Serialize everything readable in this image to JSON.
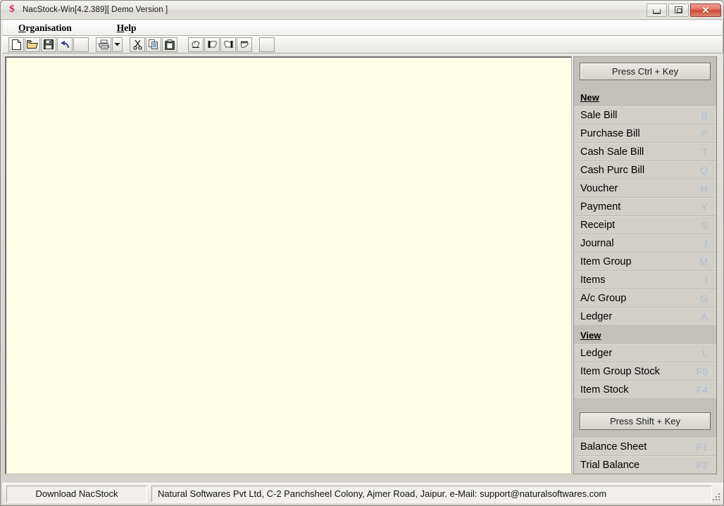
{
  "window": {
    "title": "NacStock-Win[4.2.389][ Demo Version ]",
    "icon": "dollar-sign-icon",
    "controls": {
      "minimize": "minimize-icon",
      "restore": "restore-icon",
      "close": "✕"
    }
  },
  "menubar": {
    "items": [
      {
        "accel": "O",
        "rest": "rganisation"
      },
      {
        "accel": "H",
        "rest": "elp"
      }
    ]
  },
  "toolbar": {
    "buttons": [
      {
        "name": "new-file-icon"
      },
      {
        "name": "open-folder-icon"
      },
      {
        "name": "save-icon"
      },
      {
        "name": "undo-icon"
      },
      {
        "name": "blank-icon"
      },
      {
        "name": "print-icon"
      },
      {
        "name": "print-dropdown-icon"
      },
      {
        "name": "cut-icon"
      },
      {
        "name": "copy-icon"
      },
      {
        "name": "paste-icon"
      },
      {
        "name": "first-record-icon"
      },
      {
        "name": "previous-record-icon"
      },
      {
        "name": "next-record-icon"
      },
      {
        "name": "last-record-icon"
      },
      {
        "name": "blank-trailing-icon"
      }
    ]
  },
  "sidebar": {
    "ctrl_button_label": "Press Ctrl + Key",
    "shift_button_label": "Press Shift + Key",
    "new_header": "New",
    "view_header": "View",
    "new_items": [
      {
        "label": "Sale Bill",
        "key": "B"
      },
      {
        "label": "Purchase Bill",
        "key": "P"
      },
      {
        "label": "Cash Sale Bill",
        "key": "T"
      },
      {
        "label": "Cash Purc Bill",
        "key": "Q"
      },
      {
        "label": "Voucher",
        "key": "H"
      },
      {
        "label": "Payment",
        "key": "Y"
      },
      {
        "label": "Receipt",
        "key": "S"
      },
      {
        "label": "Journal",
        "key": "J"
      },
      {
        "label": "Item Group",
        "key": "M"
      },
      {
        "label": "Items",
        "key": "I"
      },
      {
        "label": "A/c Group",
        "key": "G"
      },
      {
        "label": "Ledger",
        "key": "A"
      }
    ],
    "view_items": [
      {
        "label": "Ledger",
        "key": "L"
      },
      {
        "label": "Item Group Stock",
        "key": "F5"
      },
      {
        "label": "Item Stock",
        "key": "F4"
      }
    ],
    "shift_items": [
      {
        "label": "Balance Sheet",
        "key": "F1"
      },
      {
        "label": "Trial Balance",
        "key": "F2"
      }
    ]
  },
  "statusbar": {
    "download_label": "Download NacStock",
    "info_text": "Natural Softwares Pvt Ltd, C-2 Panchsheel Colony, Ajmer Road, Jaipur. e-Mail: support@naturalsoftwares.com"
  },
  "colors": {
    "canvas": "#ffffe8",
    "sidebar_bg": "#c3c0ba",
    "row_bg": "#d2cfc9",
    "shortcut_key": "#a9bdd4",
    "close_button": "#cf4a33",
    "app_icon": "#d81e5b"
  }
}
